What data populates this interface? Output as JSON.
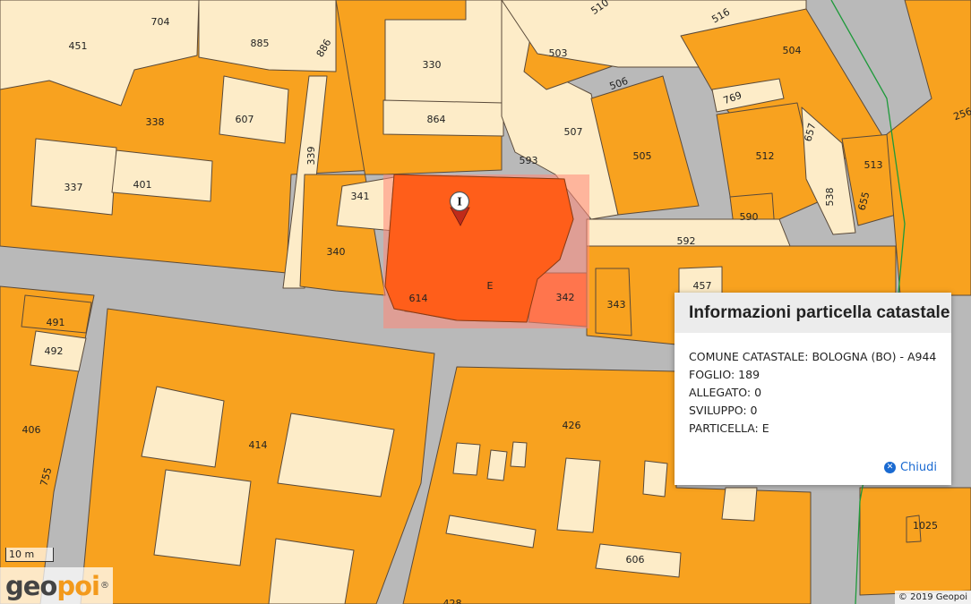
{
  "map": {
    "parcel_labels": [
      "704",
      "451",
      "885",
      "886",
      "510",
      "516",
      "330",
      "503",
      "504",
      "338",
      "607",
      "506",
      "864",
      "769",
      "256",
      "507",
      "593",
      "339",
      "505",
      "512",
      "657",
      "513",
      "337",
      "401",
      "341",
      "590",
      "538",
      "655",
      "592",
      "340",
      "457",
      "E",
      "614",
      "342",
      "343",
      "491",
      "492",
      "426",
      "406",
      "414",
      "755",
      "606",
      "428",
      "1025"
    ],
    "colors": {
      "parcel_orange": "#f8a21f",
      "parcel_cream": "#fdecc8",
      "street_gray": "#b9b9b9",
      "selected_fill": "#ff5e1a",
      "selection_box": "#ff8878",
      "outline": "#5a4a3a",
      "boundary_green": "#1e9a3a"
    },
    "marker_icon": "map-pin-icon",
    "marker_glyph": "I"
  },
  "popup": {
    "title": "Informazioni particella catastale",
    "rows": [
      "COMUNE CATASTALE: BOLOGNA (BO) - A944",
      "FOGLIO: 189",
      "ALLEGATO: 0",
      "SVILUPPO: 0",
      "PARTICELLA: E"
    ],
    "close_icon": "close-circle-icon",
    "close_label": "Chiudi"
  },
  "scale_bar": {
    "label": "10 m"
  },
  "logo": {
    "part1": "geo",
    "part2": "poi",
    "mark": "®"
  },
  "copyright": "© 2019 Geopoi"
}
